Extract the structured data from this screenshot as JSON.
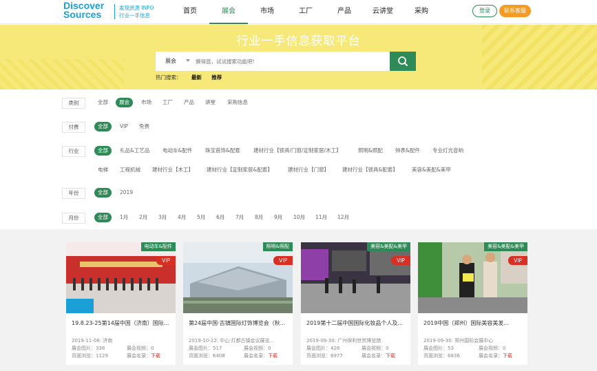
{
  "header": {
    "logo_line1": "Discover",
    "logo_line2": "Sources",
    "logo_sub1": "发现资源 INFO",
    "logo_sub2": "行业一手信息",
    "nav": [
      "首页",
      "展会",
      "市场",
      "工厂",
      "产品",
      "云讲堂",
      "采购"
    ],
    "nav_active": "展会",
    "login": "登录",
    "contact": "联系客服"
  },
  "banner": {
    "title": "行业一手信息获取平台",
    "search_category": "展会",
    "search_placeholder": "懒得逛，试试搜索功能吧!",
    "hot_label": "热门搜索：",
    "hot_items": [
      "最新",
      "推荐"
    ]
  },
  "filters": {
    "type": {
      "label": "类别",
      "options": [
        "全部",
        "展会",
        "市场",
        "工厂",
        "产品",
        "讲堂",
        "采购信息"
      ],
      "selected": "展会"
    },
    "paid": {
      "label": "付费",
      "options": [
        "全部",
        "VIP",
        "免费"
      ],
      "selected": "全部"
    },
    "industry": {
      "label": "行业",
      "options": [
        "全部",
        "礼品&工艺品",
        "电动车&配件",
        "珠宝首饰&配套",
        "建材行业【锁具/门窗/定制家居/木工】",
        "照明&照配",
        "钟表&配件",
        "专业灯光音响",
        "电梯",
        "工程机械",
        "建材行业【木工】",
        "建材行业【定制家居&配套】",
        "建材行业【门窗】",
        "建材行业【锁具&配套】",
        "美容&美配&美甲"
      ],
      "selected": "全部"
    },
    "year": {
      "label": "年份",
      "options": [
        "全部",
        "2019"
      ],
      "selected": "全部"
    },
    "month": {
      "label": "月份",
      "options": [
        "全部",
        "1月",
        "2月",
        "3月",
        "4月",
        "5月",
        "6月",
        "7月",
        "8月",
        "9月",
        "10月",
        "11月",
        "12月"
      ],
      "selected": "全部"
    }
  },
  "cards": [
    {
      "tag": "电动车&配件",
      "vip": "VIP",
      "title": "19.8.23-25第14届中国（济南）国际...",
      "date_place": "2019-11-08:  济南",
      "pics_label": "展会图片：",
      "pics": "338",
      "videos_label": "展会视频：",
      "videos": "0",
      "views_label": "页面浏览：",
      "views": "1129",
      "list_label": "展会名录：",
      "download": "下载"
    },
    {
      "tag": "照明&照配",
      "vip": "VIP",
      "title": "第24届中国·古镇国际灯饰博览会（秋...",
      "date_place": "2019-10-22:  中山·灯都古镇会议展览...",
      "pics_label": "展会图片：",
      "pics": "517",
      "videos_label": "展会视频：",
      "videos": "0",
      "views_label": "页面浏览：",
      "views": "6408",
      "list_label": "展会名录：",
      "download": "下载"
    },
    {
      "tag": "美容&美配&美甲",
      "vip": "VIP",
      "title": "2019第十二届中国国际化妆品个人及...",
      "date_place": "2019-09-30:  广州保利世贸博览馆",
      "pics_label": "展会图片：",
      "pics": "426",
      "videos_label": "展会视频：",
      "videos": "0",
      "views_label": "页面浏览：",
      "views": "6977",
      "list_label": "展会名录：",
      "download": "下载"
    },
    {
      "tag": "美容&美配&美甲",
      "vip": "VIP",
      "title": "2019中国（郑州）国际美容美发...",
      "date_place": "2019-09-30:  郑州国际会展中心",
      "pics_label": "展会图片：",
      "pics": "53",
      "videos_label": "展会视频：",
      "videos": "0",
      "views_label": "页面浏览：",
      "views": "6836",
      "list_label": "展会名录：",
      "download": "下载"
    }
  ],
  "colors": {
    "brand_green": "#2e8b57",
    "accent_orange": "#f59a23",
    "banner_yellow": "#f6e97a",
    "vip_red": "#d93025",
    "logo_blue": "#1a9fd6"
  },
  "icons": {
    "search": "search-icon",
    "dropdown": "caret-down-icon"
  }
}
